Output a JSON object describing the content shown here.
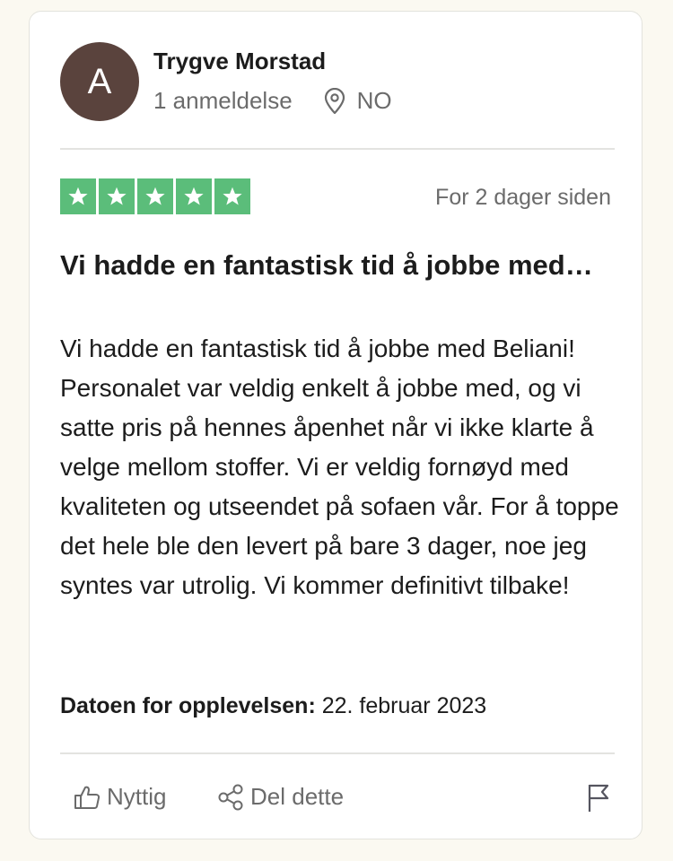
{
  "reviewer": {
    "avatar_initial": "A",
    "name": "Trygve Morstad",
    "review_count": "1 anmeldelse",
    "country": "NO"
  },
  "review": {
    "rating": 5,
    "rating_max": 5,
    "star_color": "#5bbd7a",
    "date": "For 2 dager siden",
    "title": "Vi hadde en fantastisk tid å jobbe med…",
    "body": "Vi hadde en fantastisk tid å jobbe med Beliani! Personalet var veldig enkelt å jobbe med, og vi satte pris på hennes åpenhet når vi ikke klarte å velge mellom stoffer. Vi er veldig fornøyd med kvaliteten og utseendet på sofaen vår. For å toppe det hele ble den levert på bare 3 dager, noe jeg syntes var utrolig. Vi kommer definitivt tilbake!",
    "experience_label": "Datoen for opplevelsen:",
    "experience_date": "22. februar 2023"
  },
  "actions": {
    "helpful_label": "Nyttig",
    "share_label": "Del dette"
  },
  "icons": {
    "location": "location-pin-icon",
    "star": "star-icon",
    "helpful": "thumbs-up-icon",
    "share": "share-icon",
    "report": "flag-icon"
  },
  "colors": {
    "avatar_bg": "#5a433d",
    "page_bg": "#fbf9f1",
    "muted_text": "#6b6b6b"
  }
}
